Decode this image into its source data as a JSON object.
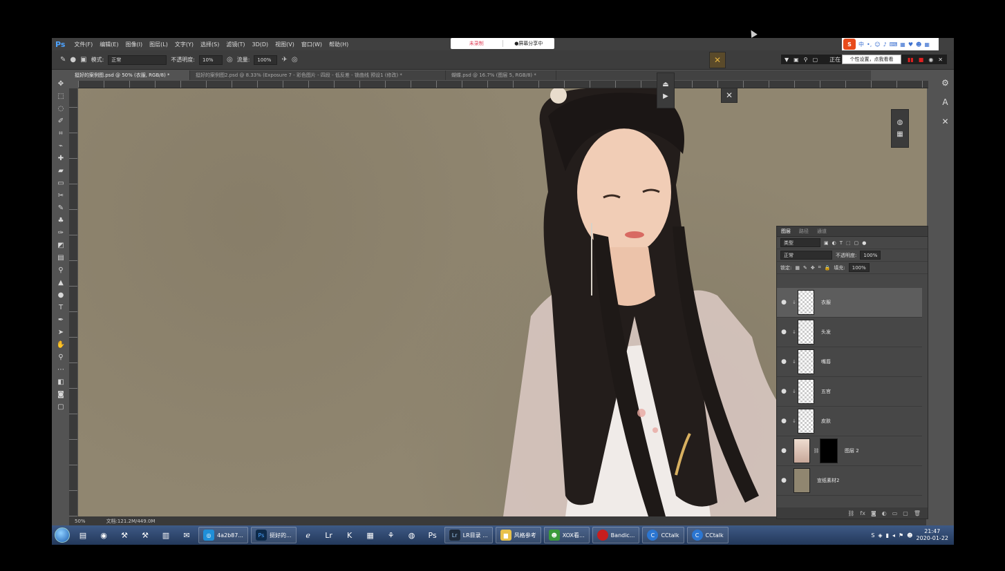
{
  "app": {
    "logo": "Ps",
    "menu": [
      "文件(F)",
      "编辑(E)",
      "图像(I)",
      "图层(L)",
      "文字(Y)",
      "选择(S)",
      "滤镜(T)",
      "3D(D)",
      "视图(V)",
      "窗口(W)",
      "帮助(H)"
    ]
  },
  "recorder": {
    "not_recording": "未录制",
    "screen_share": "●屏幕分享中",
    "status_prefix": "正在"
  },
  "ime": {
    "logo": "S",
    "mode": "中",
    "tooltip": "个性设置，点我看看"
  },
  "options": {
    "mode_label": "模式:",
    "mode_value": "正常",
    "opacity_label": "不透明度:",
    "opacity_value": "10%",
    "flow_label": "流量:",
    "flow_value": "100%"
  },
  "tabs": [
    {
      "label": "挺好的案例图.psd @ 50% (衣服, RGB/8) *",
      "active": true
    },
    {
      "label": "挺好的案例图2.psd @ 8.33% (Exposure 7 - 彩色图片 - 四段 - 低反差 - 锁曲线 预设1 (修改) *",
      "active": false
    },
    {
      "label": "蝴蝶.psd @ 16.7% (图层 5, RGB/8) *",
      "active": false
    }
  ],
  "status": {
    "zoom": "50%",
    "doc_info": "文档:121.2M/449.0M"
  },
  "layers_panel": {
    "tabs": [
      "图层",
      "路径",
      "通道"
    ],
    "filter_kind": "类型",
    "blend_mode": "正常",
    "opacity_label": "不透明度:",
    "opacity_value": "100%",
    "lock_label": "锁定:",
    "fill_label": "填充:",
    "fill_value": "100%",
    "layers": [
      {
        "name": "衣服",
        "active": true,
        "thumb": "transparent"
      },
      {
        "name": "头发",
        "active": false,
        "thumb": "transparent"
      },
      {
        "name": "嘴唇",
        "active": false,
        "thumb": "transparent"
      },
      {
        "name": "五官",
        "active": false,
        "thumb": "transparent"
      },
      {
        "name": "皮肤",
        "active": false,
        "thumb": "transparent"
      },
      {
        "name": "图层 2",
        "active": false,
        "thumb": "photo"
      },
      {
        "name": "宣纸素材2",
        "active": false,
        "thumb": "paper"
      }
    ]
  },
  "taskbar": {
    "buttons": [
      {
        "label": "4a2b87...",
        "icon": "browser-icon",
        "color": "#1f8fd8"
      },
      {
        "label": "挺好的...",
        "icon": "photoshop-icon",
        "color": "#0d2a4a"
      },
      {
        "label": "LR目录 ...",
        "icon": "lightroom-icon",
        "color": "#1f2b3a"
      },
      {
        "label": "风格参考",
        "icon": "folder-icon",
        "color": "#e8c14a"
      },
      {
        "label": "XOX看...",
        "icon": "app-icon",
        "color": "#3a9a3a"
      },
      {
        "label": "Bandic...",
        "icon": "record-icon",
        "color": "#c81e1e"
      },
      {
        "label": "CCtalk",
        "icon": "cctalk-icon",
        "color": "#2b76d2"
      },
      {
        "label": "CCtalk",
        "icon": "cctalk-icon",
        "color": "#2b76d2"
      }
    ],
    "pinned_labels": [
      "Lr",
      "K",
      "Ps"
    ],
    "clock_time": "21:47",
    "clock_date": "2020-01-22"
  }
}
